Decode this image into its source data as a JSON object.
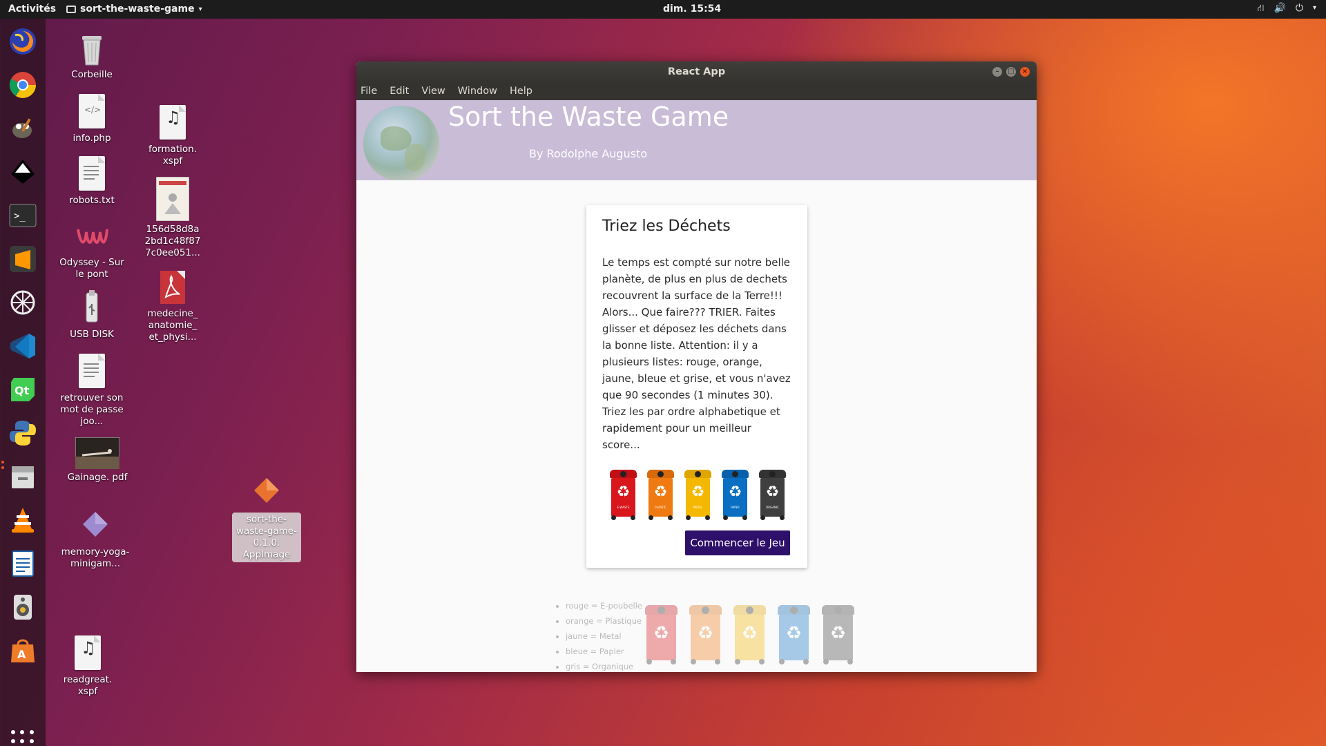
{
  "topbar": {
    "activities": "Activités",
    "app_menu": "sort-the-waste-game",
    "clock": "dim. 15:54"
  },
  "dock": {
    "items": [
      "firefox-icon",
      "chrome-icon",
      "gimp-icon",
      "inkscape-icon",
      "terminal-icon",
      "sublime-text-icon",
      "network-icon",
      "vscode-icon",
      "qt-creator-icon",
      "python-icon",
      "files-icon",
      "vlc-icon",
      "writer-icon",
      "speaker-icon",
      "software-center-icon"
    ]
  },
  "desktop": {
    "icons": [
      {
        "label": "Corbeille"
      },
      {
        "label": "info.php"
      },
      {
        "label": "robots.txt"
      },
      {
        "label": "Odyssey - Sur le pont"
      },
      {
        "label": "USB DISK"
      },
      {
        "label": "retrouver son mot de passe joo..."
      },
      {
        "label": "Gainage. pdf"
      },
      {
        "label": "memory-yoga-minigam..."
      },
      {
        "label": "readgreat. xspf"
      },
      {
        "label": "formation. xspf"
      },
      {
        "label": "156d58d8a 2bd1c48f87 7c0ee051..."
      },
      {
        "label": "medecine_ anatomie_ et_physi..."
      },
      {
        "label": "sort-the-waste-game-0.1.0. AppImage"
      }
    ]
  },
  "window": {
    "title": "React App",
    "menu": [
      "File",
      "Edit",
      "View",
      "Window",
      "Help"
    ]
  },
  "app": {
    "title": "Sort the Waste Game",
    "author": "By Rodolphe Augusto",
    "card": {
      "heading": "Triez les Déchets",
      "text": "Le temps est compté sur notre belle planète, de plus en plus de dechets recouvrent la surface de la Terre!!! Alors... Que faire??? TRIER. Faites glisser et déposez les déchets dans la bonne liste. Attention: il y a plusieurs listes: rouge, orange, jaune, bleue et grise, et vous n'avez que 90 secondes (1 minutes 30). Triez les par ordre alphabetique et rapidement pour un meilleur score...",
      "start_button": "Commencer le Jeu"
    },
    "bins": [
      {
        "color": "#d9161c",
        "lid": "#c01015",
        "label": "E-WASTE"
      },
      {
        "color": "#f07a12",
        "lid": "#d96a0c",
        "label": "PLASTIC"
      },
      {
        "color": "#f5b800",
        "lid": "#dfa500",
        "label": "METAL"
      },
      {
        "color": "#0a6fc2",
        "lid": "#0860ab",
        "label": "PAPER"
      },
      {
        "color": "#3f3f3f",
        "lid": "#333333",
        "label": "ORGANIC"
      }
    ],
    "legend": [
      "rouge = E-poubelle",
      "orange = Plastique",
      "jaune = Metal",
      "bleue = Papier",
      "gris = Organique"
    ]
  }
}
